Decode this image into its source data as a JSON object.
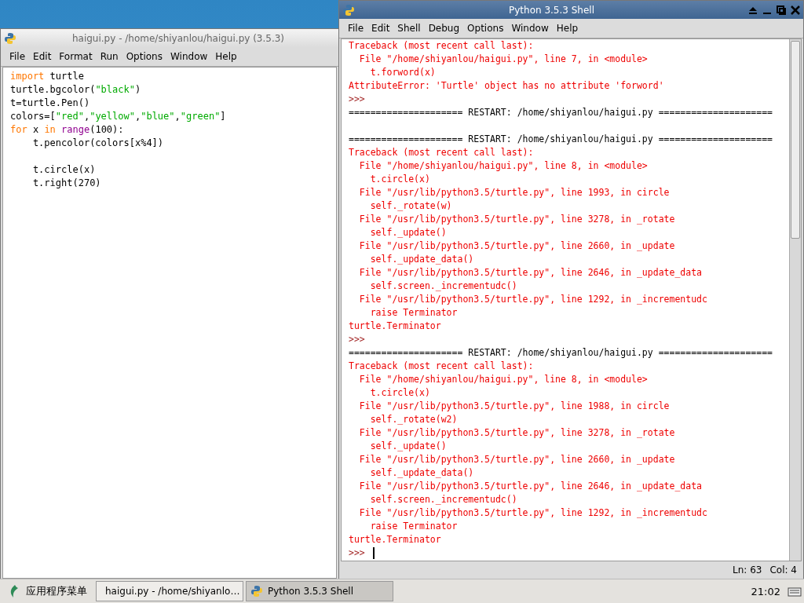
{
  "editor": {
    "title": "haigui.py - /home/shiyanlou/haigui.py (3.5.3)",
    "active": false,
    "menu": [
      "File",
      "Edit",
      "Format",
      "Run",
      "Options",
      "Window",
      "Help"
    ],
    "code": [
      {
        "kind": "code",
        "segments": [
          {
            "kind": "keyword",
            "text": "import"
          },
          {
            "kind": "plain",
            "text": " turtle"
          }
        ]
      },
      {
        "kind": "code",
        "segments": [
          {
            "kind": "plain",
            "text": "turtle.bgcolor("
          },
          {
            "kind": "string",
            "text": "\"black\""
          },
          {
            "kind": "plain",
            "text": ")"
          }
        ]
      },
      {
        "kind": "code",
        "segments": [
          {
            "kind": "plain",
            "text": "t=turtle.Pen()"
          }
        ]
      },
      {
        "kind": "code",
        "segments": [
          {
            "kind": "plain",
            "text": "colors=["
          },
          {
            "kind": "string",
            "text": "\"red\""
          },
          {
            "kind": "plain",
            "text": ","
          },
          {
            "kind": "string",
            "text": "\"yellow\""
          },
          {
            "kind": "plain",
            "text": ","
          },
          {
            "kind": "string",
            "text": "\"blue\""
          },
          {
            "kind": "plain",
            "text": ","
          },
          {
            "kind": "string",
            "text": "\"green\""
          },
          {
            "kind": "plain",
            "text": "]"
          }
        ]
      },
      {
        "kind": "code",
        "segments": [
          {
            "kind": "keyword",
            "text": "for"
          },
          {
            "kind": "plain",
            "text": " x "
          },
          {
            "kind": "keyword",
            "text": "in"
          },
          {
            "kind": "builtin",
            "text": " range"
          },
          {
            "kind": "plain",
            "text": "(100):"
          }
        ]
      },
      {
        "kind": "code",
        "segments": [
          {
            "kind": "plain",
            "text": "    t.pencolor(colors[x%4])"
          }
        ]
      },
      {
        "kind": "blank"
      },
      {
        "kind": "code",
        "segments": [
          {
            "kind": "plain",
            "text": "    t.circle(x)"
          }
        ]
      },
      {
        "kind": "code",
        "segments": [
          {
            "kind": "plain",
            "text": "    t.right(270)"
          }
        ]
      }
    ]
  },
  "shell": {
    "title": "Python 3.5.3 Shell",
    "active": true,
    "menu": [
      "File",
      "Edit",
      "Shell",
      "Debug",
      "Options",
      "Window",
      "Help"
    ],
    "lines": [
      {
        "kind": "error",
        "text": "Traceback (most recent call last):"
      },
      {
        "kind": "error",
        "text": "  File \"/home/shiyanlou/haigui.py\", line 7, in <module>"
      },
      {
        "kind": "error",
        "text": "    t.forword(x)"
      },
      {
        "kind": "error",
        "text": "AttributeError: 'Turtle' object has no attribute 'forword'"
      },
      {
        "kind": "prompt",
        "text": ">>>"
      },
      {
        "kind": "output",
        "text": "===================== RESTART: /home/shiyanlou/haigui.py ====================="
      },
      {
        "kind": "blank"
      },
      {
        "kind": "output",
        "text": "===================== RESTART: /home/shiyanlou/haigui.py ====================="
      },
      {
        "kind": "error",
        "text": "Traceback (most recent call last):"
      },
      {
        "kind": "error",
        "text": "  File \"/home/shiyanlou/haigui.py\", line 8, in <module>"
      },
      {
        "kind": "error",
        "text": "    t.circle(x)"
      },
      {
        "kind": "error",
        "text": "  File \"/usr/lib/python3.5/turtle.py\", line 1993, in circle"
      },
      {
        "kind": "error",
        "text": "    self._rotate(w)"
      },
      {
        "kind": "error",
        "text": "  File \"/usr/lib/python3.5/turtle.py\", line 3278, in _rotate"
      },
      {
        "kind": "error",
        "text": "    self._update()"
      },
      {
        "kind": "error",
        "text": "  File \"/usr/lib/python3.5/turtle.py\", line 2660, in _update"
      },
      {
        "kind": "error",
        "text": "    self._update_data()"
      },
      {
        "kind": "error",
        "text": "  File \"/usr/lib/python3.5/turtle.py\", line 2646, in _update_data"
      },
      {
        "kind": "error",
        "text": "    self.screen._incrementudc()"
      },
      {
        "kind": "error",
        "text": "  File \"/usr/lib/python3.5/turtle.py\", line 1292, in _incrementudc"
      },
      {
        "kind": "error",
        "text": "    raise Terminator"
      },
      {
        "kind": "error",
        "text": "turtle.Terminator"
      },
      {
        "kind": "prompt",
        "text": ">>>"
      },
      {
        "kind": "output",
        "text": "===================== RESTART: /home/shiyanlou/haigui.py ====================="
      },
      {
        "kind": "error",
        "text": "Traceback (most recent call last):"
      },
      {
        "kind": "error",
        "text": "  File \"/home/shiyanlou/haigui.py\", line 8, in <module>"
      },
      {
        "kind": "error",
        "text": "    t.circle(x)"
      },
      {
        "kind": "error",
        "text": "  File \"/usr/lib/python3.5/turtle.py\", line 1988, in circle"
      },
      {
        "kind": "error",
        "text": "    self._rotate(w2)"
      },
      {
        "kind": "error",
        "text": "  File \"/usr/lib/python3.5/turtle.py\", line 3278, in _rotate"
      },
      {
        "kind": "error",
        "text": "    self._update()"
      },
      {
        "kind": "error",
        "text": "  File \"/usr/lib/python3.5/turtle.py\", line 2660, in _update"
      },
      {
        "kind": "error",
        "text": "    self._update_data()"
      },
      {
        "kind": "error",
        "text": "  File \"/usr/lib/python3.5/turtle.py\", line 2646, in _update_data"
      },
      {
        "kind": "error",
        "text": "    self.screen._incrementudc()"
      },
      {
        "kind": "error",
        "text": "  File \"/usr/lib/python3.5/turtle.py\", line 1292, in _incrementudc"
      },
      {
        "kind": "error",
        "text": "    raise Terminator"
      },
      {
        "kind": "error",
        "text": "turtle.Terminator"
      },
      {
        "kind": "input",
        "text": ">>>"
      }
    ],
    "status": [
      "Ln: 63",
      "Col: 4"
    ]
  },
  "taskbar": {
    "start": "应用程序菜单",
    "tasks": [
      {
        "label": "haigui.py - /home/shiyanlo…",
        "selected": false
      },
      {
        "label": "Python 3.5.3 Shell",
        "selected": true
      }
    ],
    "clock": "21:02"
  }
}
